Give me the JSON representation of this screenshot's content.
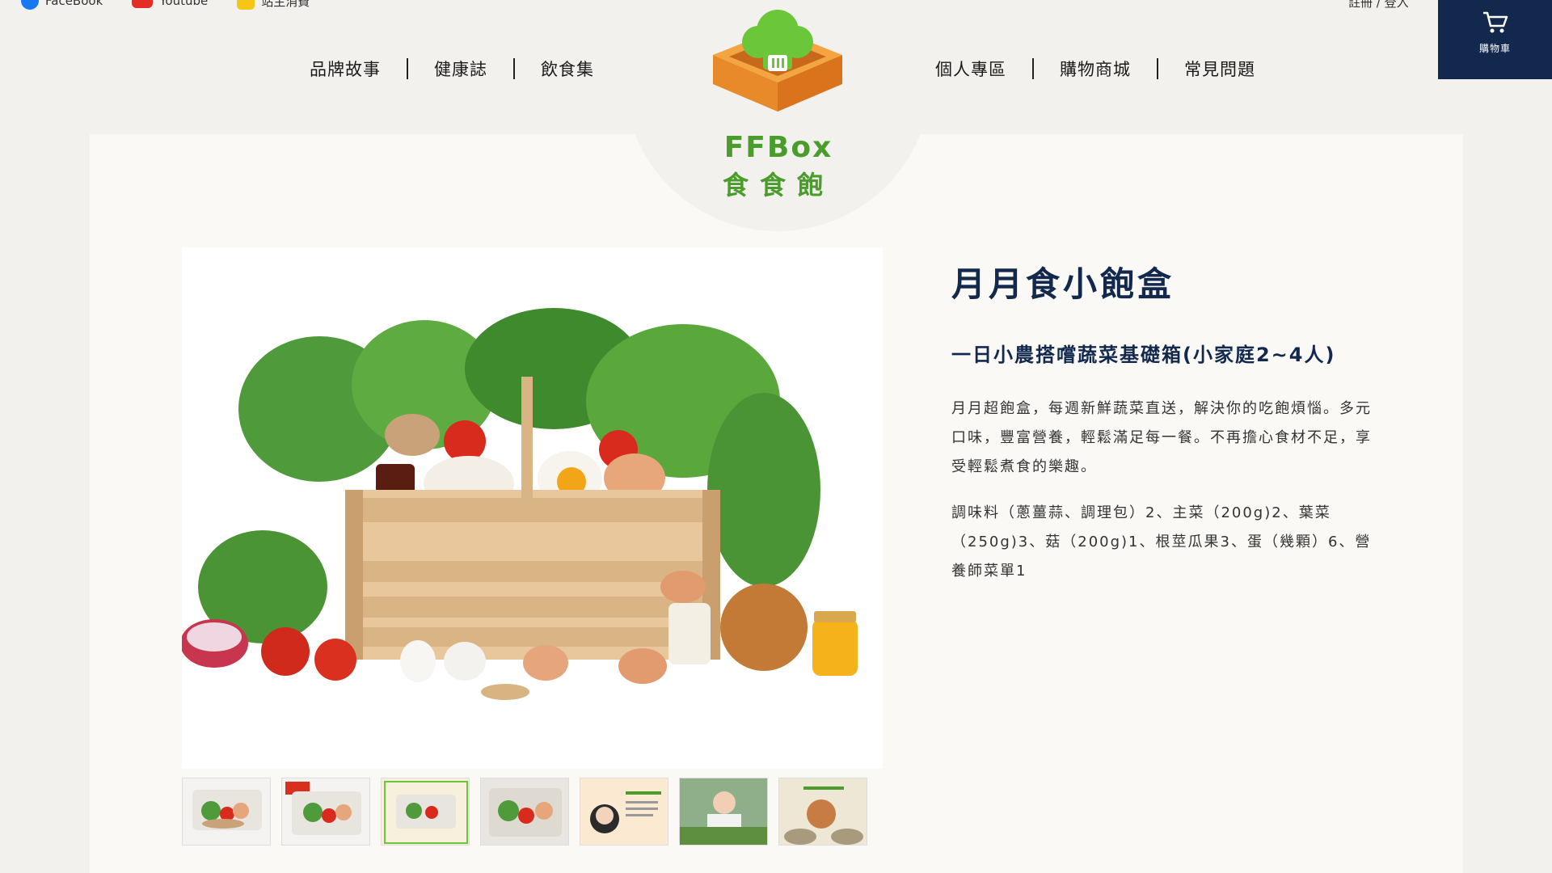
{
  "social": {
    "facebook": "FaceBook",
    "youtube": "Youtube",
    "line": "站主消費"
  },
  "account": {
    "login": "註冊 / 登入"
  },
  "cart": {
    "label": "購物車"
  },
  "nav": {
    "left": [
      "品牌故事",
      "健康誌",
      "飲食集"
    ],
    "right": [
      "個人專區",
      "購物商城",
      "常見問題"
    ]
  },
  "brand": {
    "name": "FFBox",
    "subname": "食食飽"
  },
  "product": {
    "title": "月月食小飽盒",
    "subtitle": "一日小農搭嚐蔬菜基礎箱(小家庭2~4人)",
    "description": "月月超飽盒，每週新鮮蔬菜直送，解決你的吃飽煩惱。多元口味，豐富營養，輕鬆滿足每一餐。不再擔心食材不足，享受輕鬆煮食的樂趣。",
    "contents": "調味料（蔥薑蒜、調理包）2、主菜（200g)2、葉菜（250g)3、菇（200g)1、根莖瓜果3、蛋（幾顆）6、營養師菜單1"
  },
  "colors": {
    "navy": "#13284d",
    "brand_green": "#4a9c2c",
    "box_orange": "#e8892a",
    "background": "#f3f1ed"
  }
}
